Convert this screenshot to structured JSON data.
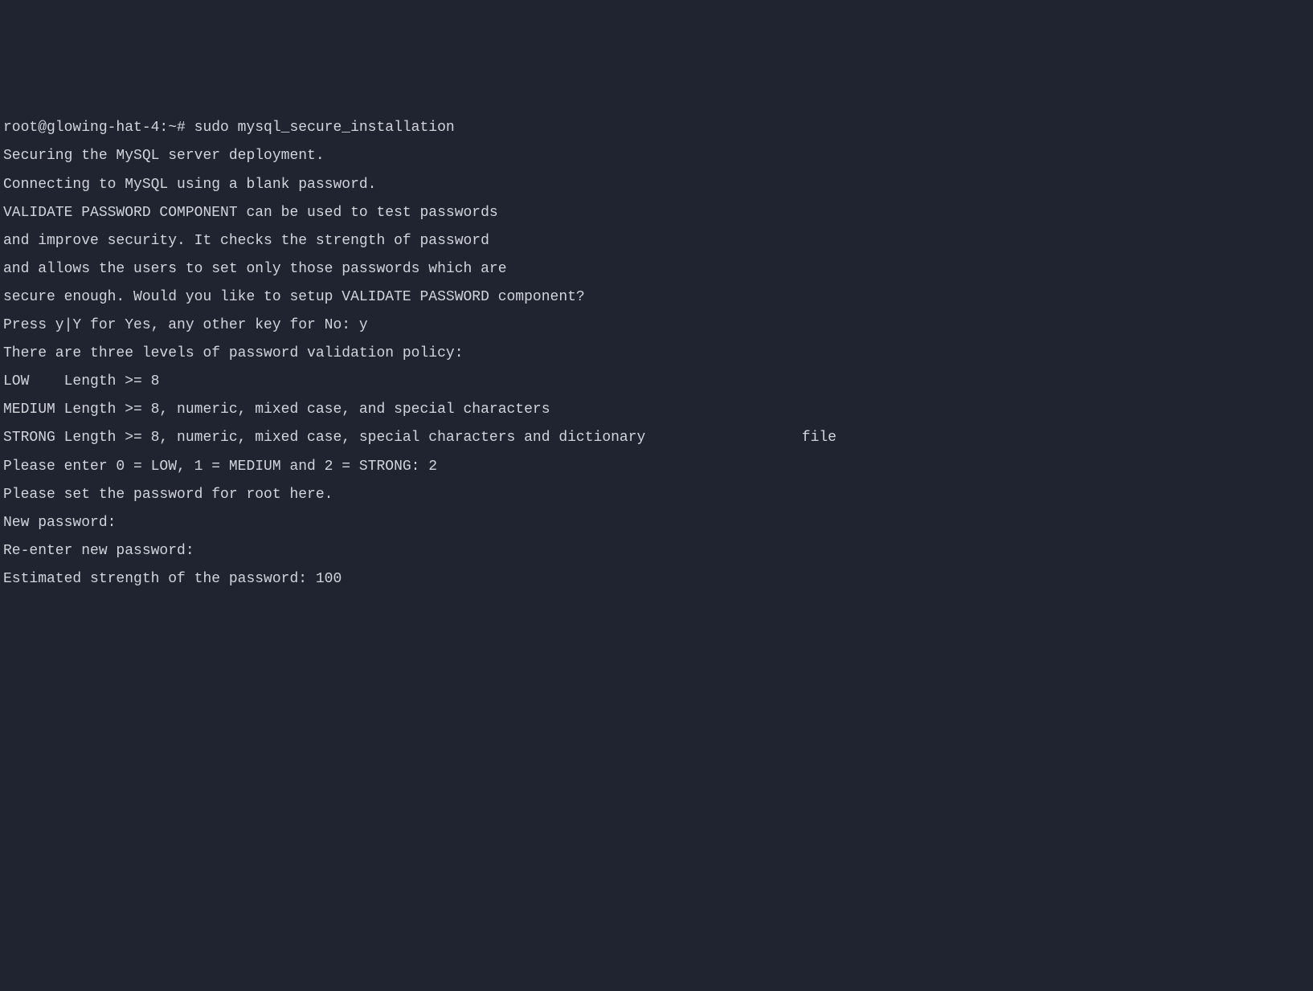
{
  "terminal": {
    "prompt": "root@glowing-hat-4:~# ",
    "command": "sudo mysql_secure_installation",
    "lines": [
      "",
      "Securing the MySQL server deployment.",
      "",
      "Connecting to MySQL using a blank password.",
      "",
      "VALIDATE PASSWORD COMPONENT can be used to test passwords",
      "and improve security. It checks the strength of password",
      "and allows the users to set only those passwords which are",
      "secure enough. Would you like to setup VALIDATE PASSWORD component?",
      "",
      "Press y|Y for Yes, any other key for No: y",
      "",
      "There are three levels of password validation policy:",
      "",
      "LOW    Length >= 8",
      "MEDIUM Length >= 8, numeric, mixed case, and special characters",
      "STRONG Length >= 8, numeric, mixed case, special characters and dictionary                  file",
      "",
      "Please enter 0 = LOW, 1 = MEDIUM and 2 = STRONG: 2",
      "Please set the password for root here.",
      "",
      "New password:",
      "",
      "Re-enter new password:",
      "",
      "Estimated strength of the password: 100"
    ]
  }
}
